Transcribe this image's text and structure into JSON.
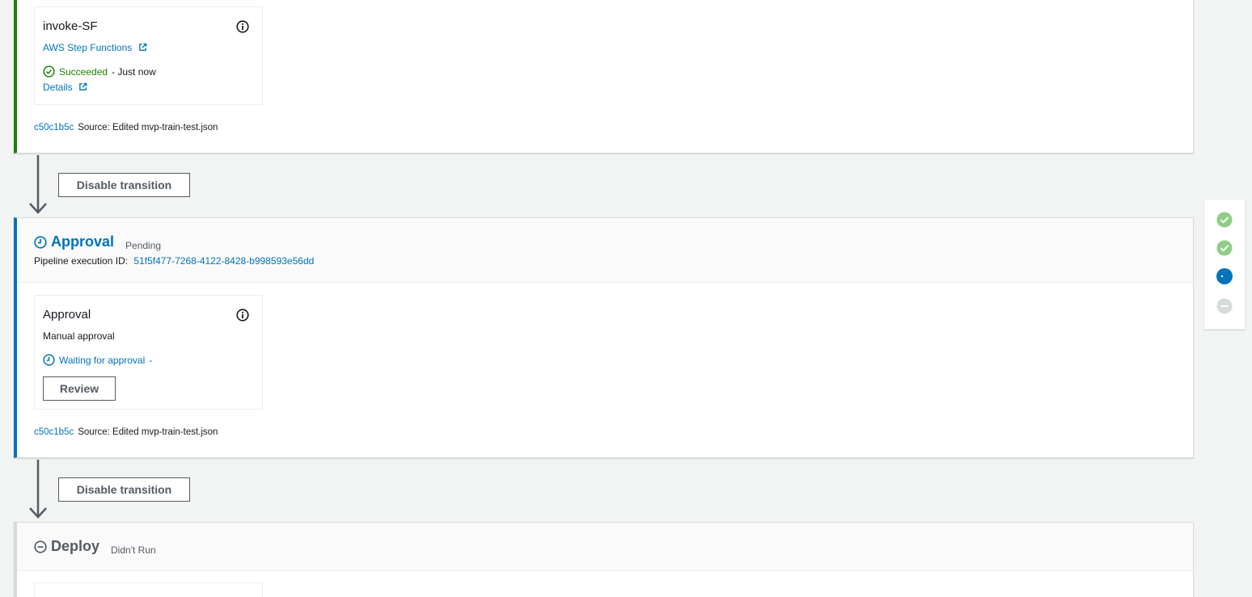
{
  "stage1": {
    "action": {
      "title": "invoke-SF",
      "provider": "AWS Step Functions",
      "status": "Succeeded",
      "status_time": "- Just now",
      "details_link": "Details"
    },
    "source": {
      "commit": "c50c1b5c",
      "message": "Source: Edited mvp-train-test.json"
    }
  },
  "transition1": {
    "label": "Disable transition"
  },
  "stage2": {
    "title": "Approval",
    "status": "Pending",
    "exec_label": "Pipeline execution ID:",
    "exec_id": "51f5f477-7268-4122-8428-b998593e56dd",
    "action": {
      "title": "Approval",
      "provider": "Manual approval",
      "status": "Waiting for approval",
      "status_time": "-",
      "review_label": "Review"
    },
    "source": {
      "commit": "c50c1b5c",
      "message": "Source: Edited mvp-train-test.json"
    }
  },
  "transition2": {
    "label": "Disable transition"
  },
  "stage3": {
    "title": "Deploy",
    "status": "Didn't Run"
  },
  "side_nav": {
    "steps": [
      "succeeded",
      "succeeded",
      "in-progress",
      "not-run"
    ]
  },
  "colors": {
    "success": "#1d8102",
    "progress": "#0073bb",
    "muted": "#545b64",
    "nav_success": "#8fce85",
    "nav_progress": "#0073bb",
    "nav_norun": "#d5dbdb"
  }
}
